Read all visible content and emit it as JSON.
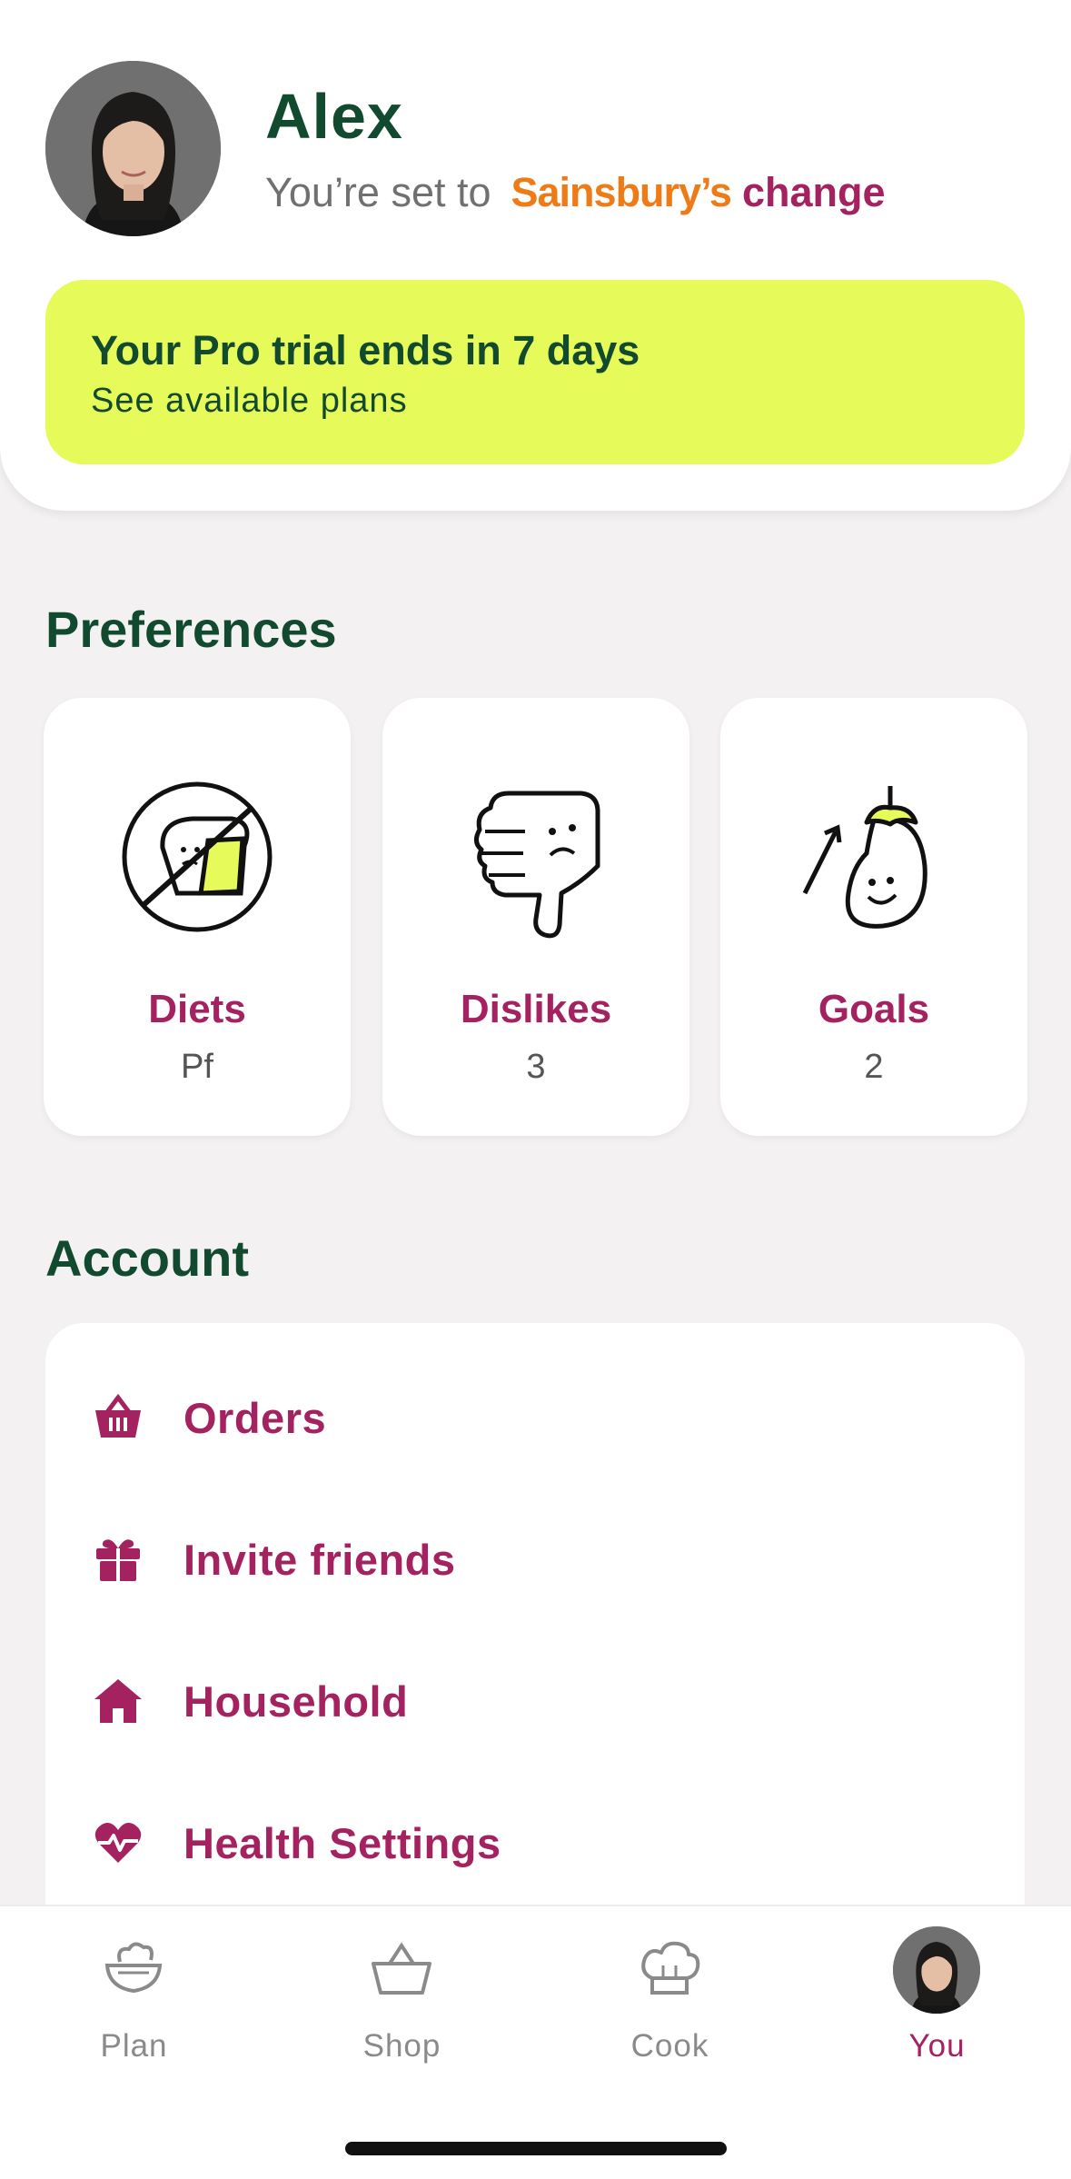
{
  "profile": {
    "name": "Alex",
    "store_prefix": "You’re set to",
    "store_name": "Sainsbury’s",
    "change_label": "change"
  },
  "trial_banner": {
    "title": "Your Pro trial ends in 7 days",
    "subtitle": "See available plans"
  },
  "preferences": {
    "title": "Preferences",
    "items": [
      {
        "label": "Diets",
        "value": "Pf",
        "icon": "no-bread-icon"
      },
      {
        "label": "Dislikes",
        "value": "3",
        "icon": "thumbs-down-icon"
      },
      {
        "label": "Goals",
        "value": "2",
        "icon": "eggplant-goal-icon"
      }
    ]
  },
  "account": {
    "title": "Account",
    "items": [
      {
        "label": "Orders",
        "icon": "basket-icon"
      },
      {
        "label": "Invite friends",
        "icon": "gift-icon"
      },
      {
        "label": "Household",
        "icon": "house-icon"
      },
      {
        "label": "Health Settings",
        "icon": "heart-pulse-icon"
      }
    ]
  },
  "tabbar": {
    "items": [
      {
        "label": "Plan",
        "icon": "plan-bowl-icon"
      },
      {
        "label": "Shop",
        "icon": "shop-basket-icon"
      },
      {
        "label": "Cook",
        "icon": "chef-hat-icon"
      },
      {
        "label": "You",
        "icon": "avatar"
      }
    ],
    "active": "You"
  },
  "colors": {
    "brand_green": "#114a2e",
    "accent_magenta": "#a4225f",
    "banner_lime": "#e6fb5a",
    "store_orange": "#ee7b16",
    "background": "#f4f1f2"
  }
}
